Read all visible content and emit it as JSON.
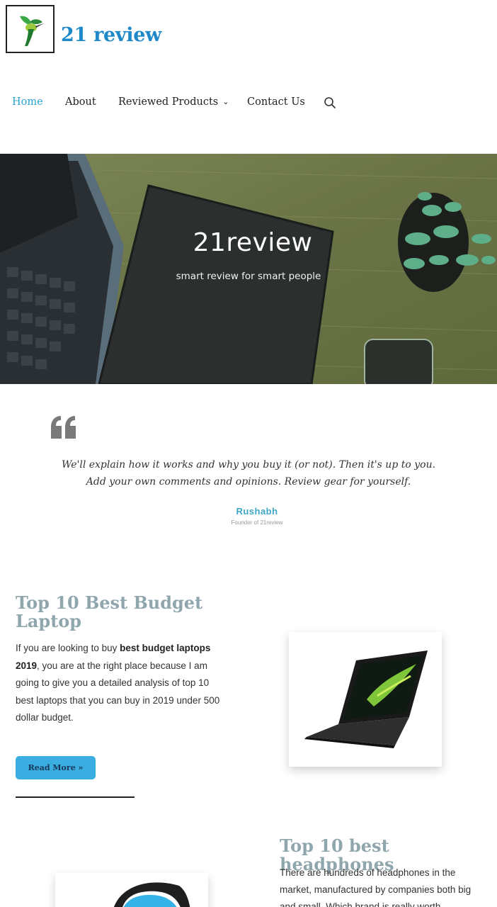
{
  "header": {
    "logo_icon": "hummingbird-logo",
    "site_title": "21 review"
  },
  "nav": {
    "items": [
      {
        "label": "Home",
        "active": true
      },
      {
        "label": "About"
      },
      {
        "label": "Reviewed Products",
        "has_dropdown": true
      },
      {
        "label": "Contact Us"
      }
    ],
    "search_icon": "search-icon",
    "chevron": "⌄"
  },
  "hero": {
    "title": "21review",
    "subtitle": "smart review for smart people"
  },
  "testimonial": {
    "quote_icon": "quote-icon",
    "line1": "We'll explain how it works and why you buy it (or not). Then it's up to you.",
    "line2": "Add your own comments and opinions. Review gear for yourself.",
    "author": "Rushabh",
    "role": "Founder of 21review"
  },
  "articles": [
    {
      "title": "Top 10 Best Budget Laptop",
      "body_pre": " If you are looking to buy ",
      "body_bold": "best budget laptops 2019",
      "body_post": ", you are at the right place because I am going to give you a detailed analysis of top 10 best laptops that you can buy in 2019 under 500 dollar budget.",
      "button_label": "Read More »"
    },
    {
      "title": "Top 10 best headphones",
      "body": " There are hundreds of headphones in the market, manufactured by companies both big and small. Which brand is really worth"
    }
  ],
  "colors": {
    "brand_blue": "#1e88c8",
    "nav_active": "#2aa3cf",
    "button": "#3aaee0",
    "heading": "#8fa6ad"
  }
}
